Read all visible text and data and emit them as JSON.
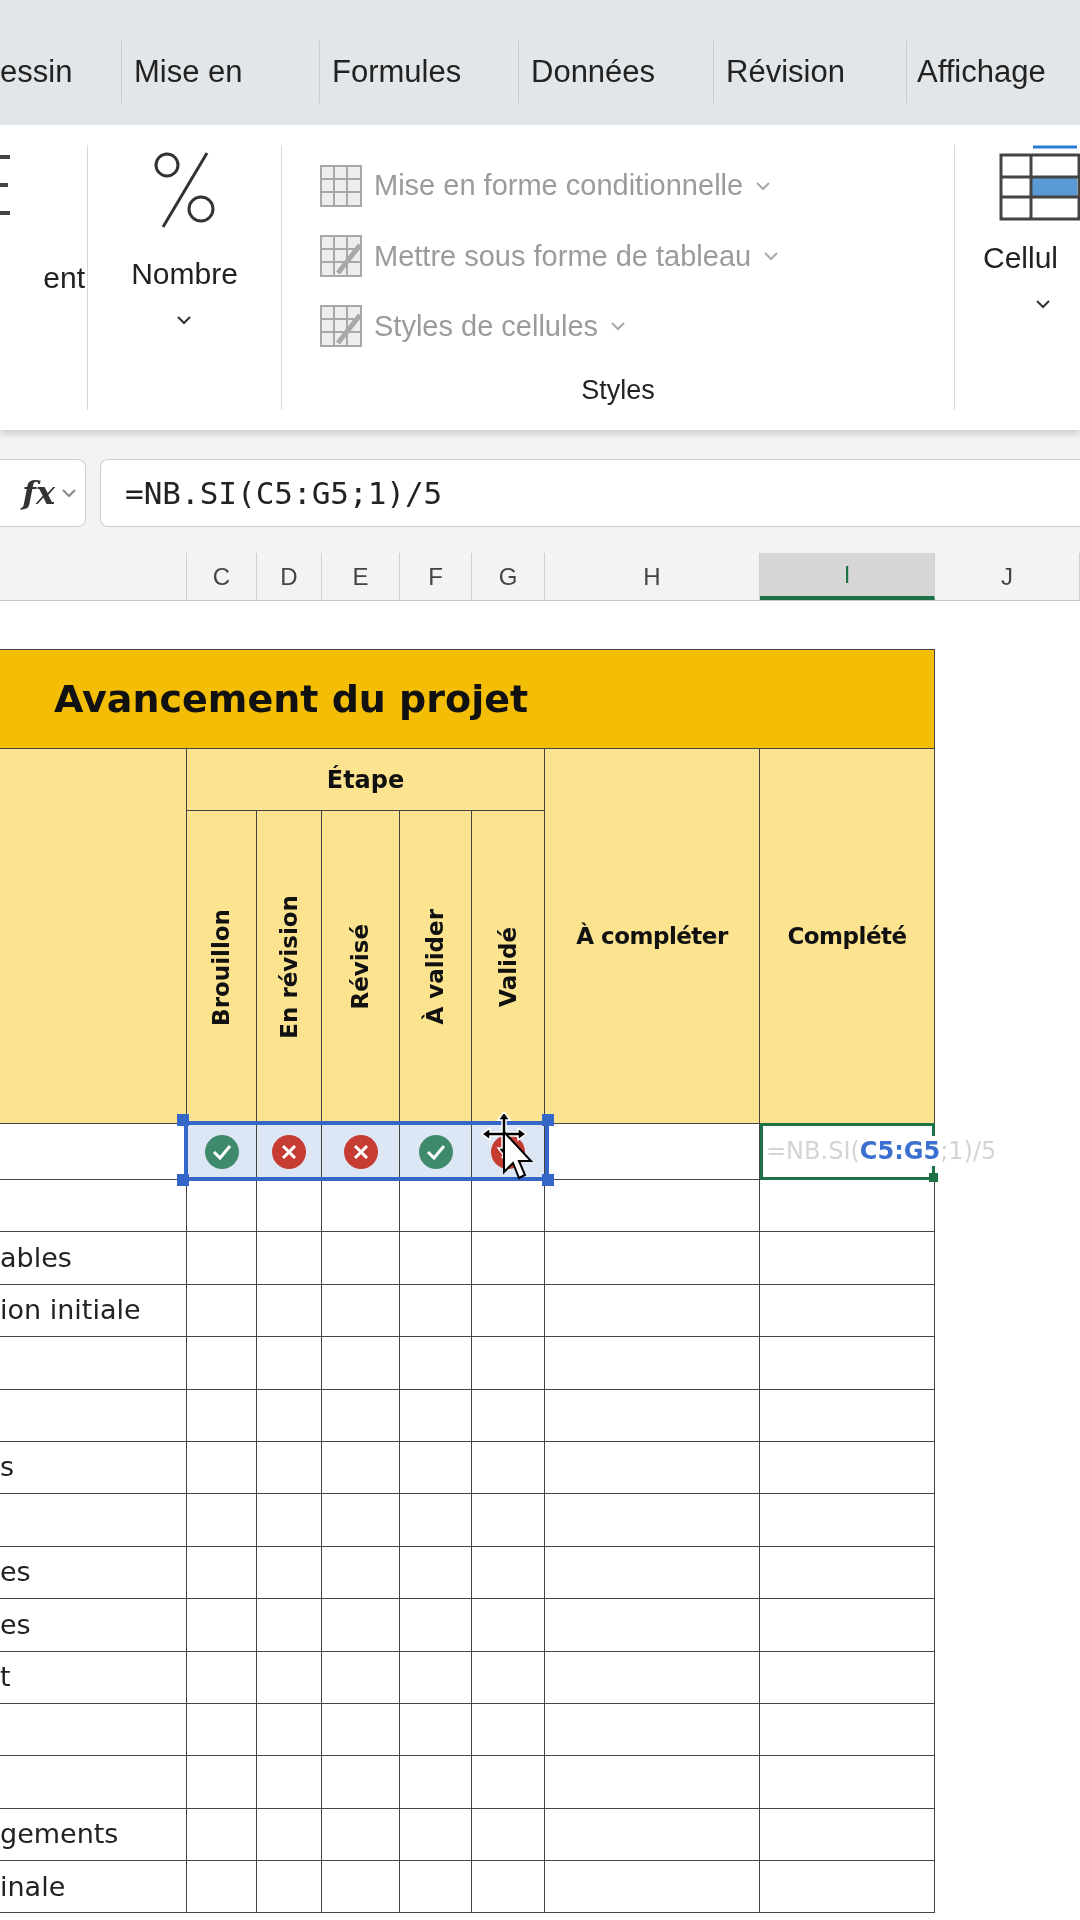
{
  "ribbon_tabs": [
    "essin",
    "Mise en",
    "Formules",
    "Données",
    "Révision",
    "Affichage"
  ],
  "ribbon": {
    "partial_group": {
      "label": "ent"
    },
    "number_group": {
      "label": "Nombre"
    },
    "styles_group": {
      "label": "Styles",
      "items": [
        {
          "label": "Mise en forme conditionnelle",
          "disabled": true
        },
        {
          "label": "Mettre sous forme de tableau",
          "disabled": true
        },
        {
          "label": "Styles de cellules",
          "disabled": true
        }
      ]
    },
    "cells_group": {
      "label": "Cellul"
    }
  },
  "formula_bar": {
    "fx_label": "fx",
    "value": "=NB.SI(C5:G5;1)/5"
  },
  "column_headers": [
    {
      "label": "C",
      "selected": false
    },
    {
      "label": "D",
      "selected": false
    },
    {
      "label": "E",
      "selected": false
    },
    {
      "label": "F",
      "selected": false
    },
    {
      "label": "G",
      "selected": false
    },
    {
      "label": "H",
      "selected": false
    },
    {
      "label": "I",
      "selected": true
    },
    {
      "label": "J",
      "selected": false
    }
  ],
  "sheet": {
    "title": "Avancement du projet",
    "group_header": "Étape",
    "stage_columns": [
      "Brouillon",
      "En révision",
      "Révisé",
      "À valider",
      "Validé"
    ],
    "other_columns": [
      "À compléter",
      "Complété"
    ],
    "status_row": {
      "stages": [
        {
          "done": true
        },
        {
          "done": false
        },
        {
          "done": false
        },
        {
          "done": true
        },
        {
          "done": false
        }
      ],
      "editing_formula": "=NB.SI(**C5:G5**;1)/5"
    },
    "rows": [
      {},
      {
        "label": "ables"
      },
      {
        "label": "ion initiale"
      },
      {},
      {},
      {
        "label": "s"
      },
      {},
      {
        "label": "es"
      },
      {
        "label": "es"
      },
      {
        "label": "t"
      },
      {},
      {},
      {
        "label": "gements"
      },
      {
        "label": "inale"
      }
    ]
  }
}
